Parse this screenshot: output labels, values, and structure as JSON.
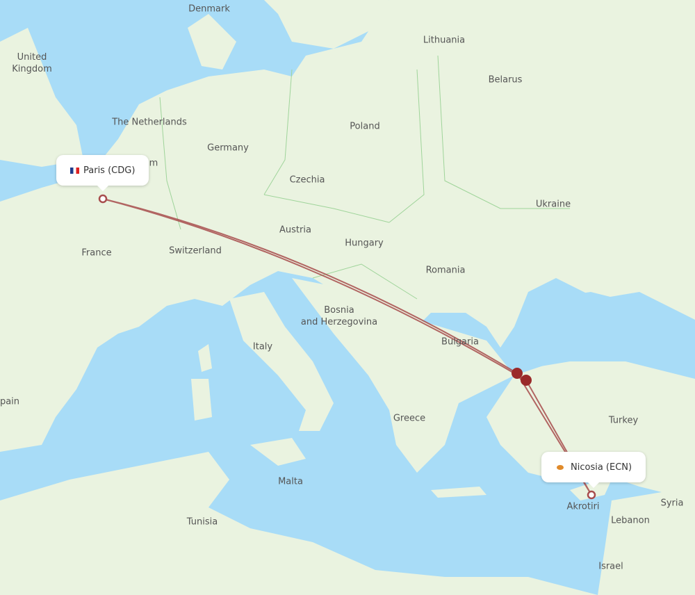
{
  "map": {
    "colors": {
      "sea": "#a8dcf7",
      "land": "#eaf3e0",
      "border": "#9fd49a",
      "route": "#a84d4d",
      "stop": "#9a2a2a"
    },
    "labels": [
      {
        "id": "denmark",
        "text": "Denmark"
      },
      {
        "id": "united-kingdom",
        "text": "United\nKingdom"
      },
      {
        "id": "lithuania",
        "text": "Lithuania"
      },
      {
        "id": "belarus",
        "text": "Belarus"
      },
      {
        "id": "the-netherlands",
        "text": "The Netherlands"
      },
      {
        "id": "germany",
        "text": "Germany"
      },
      {
        "id": "poland",
        "text": "Poland"
      },
      {
        "id": "czechia",
        "text": "Czechia"
      },
      {
        "id": "ukraine",
        "text": "Ukraine"
      },
      {
        "id": "austria",
        "text": "Austria"
      },
      {
        "id": "hungary",
        "text": "Hungary"
      },
      {
        "id": "france",
        "text": "France"
      },
      {
        "id": "switzerland",
        "text": "Switzerland"
      },
      {
        "id": "romania",
        "text": "Romania"
      },
      {
        "id": "bosnia",
        "text": "Bosnia\nand Herzegovina"
      },
      {
        "id": "italy",
        "text": "Italy"
      },
      {
        "id": "bulgaria",
        "text": "Bulgaria"
      },
      {
        "id": "spain",
        "text": "pain"
      },
      {
        "id": "greece",
        "text": "Greece"
      },
      {
        "id": "turkey",
        "text": "Turkey"
      },
      {
        "id": "malta",
        "text": "Malta"
      },
      {
        "id": "tunisia",
        "text": "Tunisia"
      },
      {
        "id": "akrotiri",
        "text": "Akrotiri"
      },
      {
        "id": "syria",
        "text": "Syria"
      },
      {
        "id": "lebanon",
        "text": "Lebanon"
      },
      {
        "id": "israel",
        "text": "Israel"
      },
      {
        "id": "belgium-partial",
        "text": "m"
      }
    ]
  },
  "origin": {
    "label": "Paris (CDG)",
    "flag": "france-flag"
  },
  "destination": {
    "label": "Nicosia (ECN)",
    "flag": "cyprus-flag"
  },
  "stops": [
    "Istanbul stop 1",
    "Istanbul stop 2"
  ]
}
